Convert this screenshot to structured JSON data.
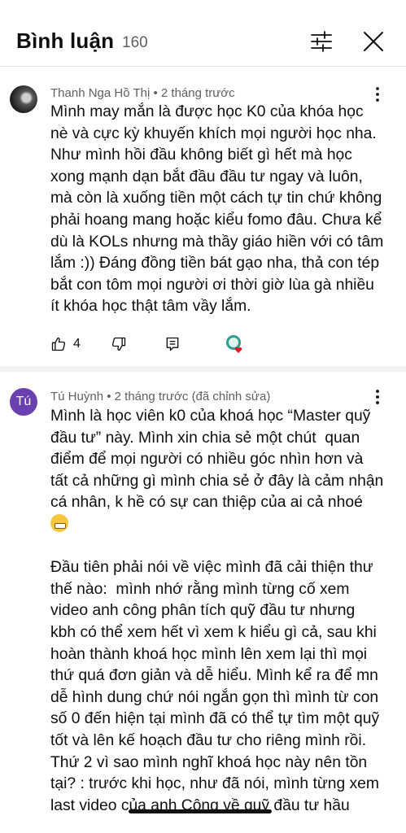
{
  "header": {
    "title": "Bình luận",
    "count": "160"
  },
  "comments": [
    {
      "author": "Thanh Nga Hồ Thị",
      "time": "2 tháng trước",
      "text": "Mình may mắn là được học K0 của khóa học nè và cực kỳ khuyến khích mọi người học nha. Như mình hồi đầu không biết gì hết mà học xong mạnh dạn bắt đầu đầu tư ngay và luôn, mà còn là xuống tiền một cách tự tin chứ không phải hoang mang hoặc kiểu fomo đâu. Chưa kể dù là KOLs nhưng mà thầy giáo hiền với có tâm lắm :)) Đáng đồng tiền bát gạo nha, thả con tép bắt con tôm mọi người ơi thời giờ lùa gà nhiều ít khóa học thật tâm vầy lắm.",
      "likes": "4"
    },
    {
      "avatar_letter": "Tú",
      "author": "Tú Huỳnh",
      "time": "2 tháng trước (đã chỉnh sửa)",
      "text_1": "Mình là học viên k0 của khoá học “Master quỹ đầu tư” này. Mình xin chia sẻ một chút  quan điểm để mọi người có nhiều góc nhìn hơn và tất cả những gì mình chia sẻ ở đây là cảm nhận cá nhân, k hề có sự can thiệp của ai cả nhoé",
      "text_2": "Đầu tiên phải nói về việc mình đã cải thiện thư thế nào:  mình nhớ rằng mình từng cố xem video anh công phân tích quỹ đầu tư nhưng kbh có thể xem hết vì xem k hiểu gì cả, sau khi hoàn thành khoá học mình lên xem lại thì mọi thứ quá đơn giản và dễ hiểu. Mình kể ra để mn dễ hình dung chứ nói ngắn gọn thì mình từ con số 0 đến hiện tại mình đã có thể tự tìm một quỹ tốt và lên kế hoạch đầu tư cho riêng mình rồi.",
      "text_3": "Thứ 2 vì sao mình nghĩ khoá học này nên tồn tại? : trước khi học, như đã nói, mình từng xem",
      "text_4": "last video của anh Công về quỹ đầu tư hầu"
    }
  ],
  "meta_separator": " • ",
  "colors": {
    "avatar_tu": "#6a3fb0",
    "heart": "#e8182a"
  }
}
